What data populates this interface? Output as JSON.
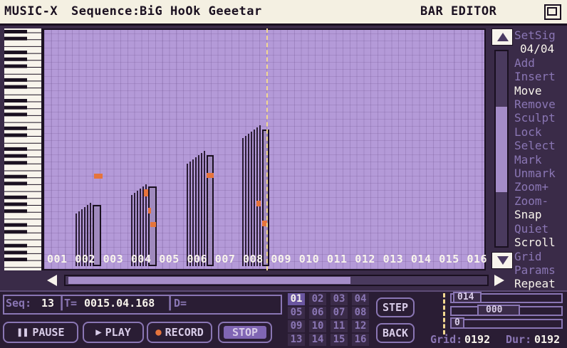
{
  "titlebar": {
    "app_name": "MUSIC-X",
    "sequence_label": "Sequence:",
    "sequence_name": "BiG HoOk Geeetar",
    "mode": "BAR EDITOR"
  },
  "bar_numbers": [
    "001",
    "002",
    "003",
    "004",
    "005",
    "006",
    "007",
    "008",
    "009",
    "010",
    "011",
    "012",
    "013",
    "014",
    "015",
    "016"
  ],
  "commands": {
    "setsig": "SetSig",
    "time_signature": "04/04",
    "items": [
      {
        "label": "Add",
        "active": false
      },
      {
        "label": "Insert",
        "active": false
      },
      {
        "label": "Move",
        "active": true
      },
      {
        "label": "Remove",
        "active": false
      },
      {
        "label": "Sculpt",
        "active": false
      },
      {
        "label": "Lock",
        "active": false
      },
      {
        "label": "Select",
        "active": false
      },
      {
        "label": "Mark",
        "active": false
      },
      {
        "label": "Unmark",
        "active": false
      },
      {
        "label": "Zoom+",
        "active": false
      },
      {
        "label": "Zoom-",
        "active": false
      },
      {
        "label": "Snap",
        "active": true
      },
      {
        "label": "Quiet",
        "active": false
      },
      {
        "label": "Scroll",
        "active": true
      },
      {
        "label": "Grid",
        "active": false
      },
      {
        "label": "Params",
        "active": false
      },
      {
        "label": "Repeat",
        "active": true
      }
    ]
  },
  "status": {
    "seq_label": "Seq:",
    "seq_value": "13",
    "time_label": "T=",
    "time_value": "0015.04.168",
    "d_label": "D="
  },
  "transport": {
    "pause": "PAUSE",
    "play": "PLAY",
    "record": "RECORD",
    "stop": "STOP"
  },
  "tracks": [
    "01",
    "02",
    "03",
    "04",
    "05",
    "06",
    "07",
    "08",
    "09",
    "10",
    "11",
    "12",
    "13",
    "14",
    "15",
    "16"
  ],
  "step_buttons": {
    "step": "STEP",
    "back": "BACK"
  },
  "right_panel": {
    "value_1": "014",
    "value_2": "000",
    "value_3": "0",
    "grid_label": "Grid:",
    "grid_value": "0192",
    "dur_label": "Dur:",
    "dur_value": "0192"
  },
  "colors": {
    "grid_bg": "#b49ad8",
    "title_bg": "#f4f0e2",
    "note_color": "#2a1c34",
    "velocity_color": "#e6743c",
    "active_text": "#f8f4ec",
    "inactive_text": "#8a76b4"
  }
}
